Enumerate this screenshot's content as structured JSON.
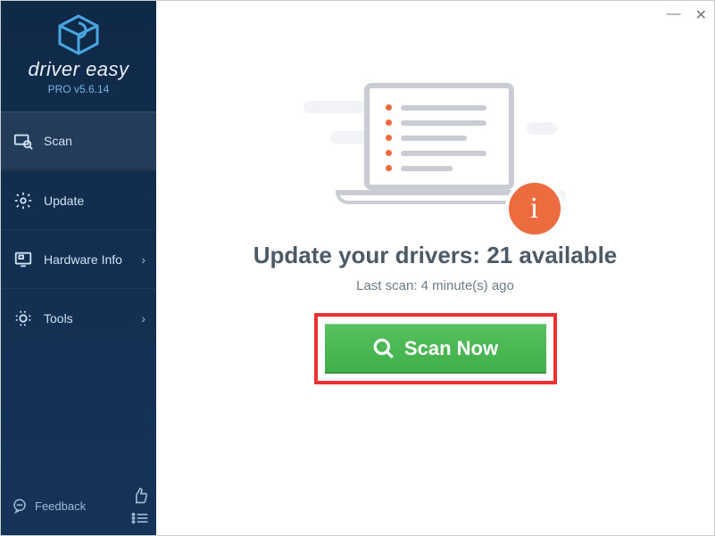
{
  "brand": {
    "name": "driver easy",
    "version": "PRO v5.6.14"
  },
  "sidebar": {
    "items": [
      {
        "label": "Scan",
        "has_chevron": false
      },
      {
        "label": "Update",
        "has_chevron": false
      },
      {
        "label": "Hardware Info",
        "has_chevron": true
      },
      {
        "label": "Tools",
        "has_chevron": true
      }
    ],
    "feedback_label": "Feedback"
  },
  "main": {
    "headline_prefix": "Update your drivers: ",
    "available_count": 21,
    "headline_suffix": " available",
    "last_scan": "Last scan: 4 minute(s) ago",
    "scan_button": "Scan Now"
  },
  "colors": {
    "accent_orange": "#ec6b3f",
    "accent_green": "#4bb955",
    "annotation_red": "#ea3232",
    "sidebar_bg": "#153358"
  }
}
